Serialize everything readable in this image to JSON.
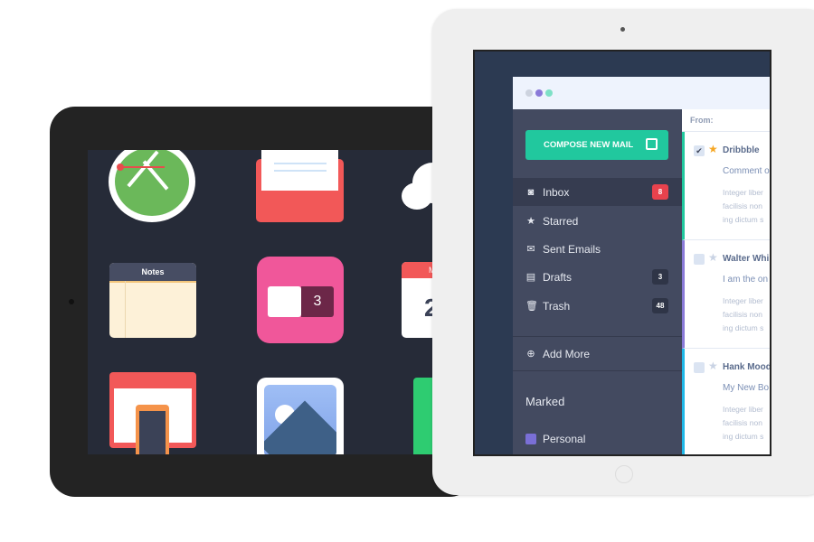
{
  "home_screen": {
    "notes_label": "Notes",
    "dribbble_count": "3",
    "calendar_month_partial": "M",
    "calendar_day_partial": "2"
  },
  "mail": {
    "compose_label": "COMPOSE NEW MAIL",
    "nav": [
      {
        "label": "Inbox",
        "icon": "inbox-icon",
        "badge": "8",
        "badge_color": "#e8424d"
      },
      {
        "label": "Starred",
        "icon": "star-icon"
      },
      {
        "label": "Sent Emails",
        "icon": "envelope-icon"
      },
      {
        "label": "Drafts",
        "icon": "drafts-icon",
        "badge": "3"
      },
      {
        "label": "Trash",
        "icon": "trash-icon",
        "badge": "48"
      }
    ],
    "add_more": "Add More",
    "marked_heading": "Marked",
    "marked": [
      {
        "label": "Personal",
        "color": "#7a6fd6"
      }
    ],
    "from_label": "From:",
    "messages": [
      {
        "sender": "Dribbble",
        "subject": "Comment o",
        "body": [
          "Integer liber",
          "facilisis non",
          "ing dictum s"
        ],
        "checked": true,
        "starred": true,
        "accent": "#21c89e"
      },
      {
        "sender": "Walter Whi",
        "subject": "I am the on",
        "body": [
          "Integer liber",
          "facilisis non",
          "ing dictum s"
        ],
        "checked": false,
        "starred": false,
        "accent": "#8a7ad8"
      },
      {
        "sender": "Hank Mood",
        "subject": "My New Bo",
        "body": [
          "Integer liber",
          "facilisis non",
          "ing dictum s"
        ],
        "checked": false,
        "starred": false,
        "accent": "#1fb8e8"
      }
    ]
  }
}
